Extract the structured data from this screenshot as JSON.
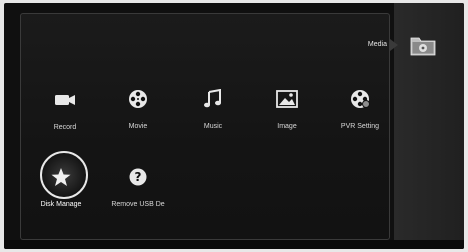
{
  "header": {
    "current_section": "Media"
  },
  "menu": {
    "items": [
      {
        "label": "Record",
        "icon": "camera-icon"
      },
      {
        "label": "Movie",
        "icon": "film-reel-icon"
      },
      {
        "label": "Music",
        "icon": "music-note-icon"
      },
      {
        "label": "Image",
        "icon": "picture-icon"
      },
      {
        "label": "PVR Setting",
        "icon": "film-reel-gear-icon"
      },
      {
        "label": "Disk Manage",
        "icon": "star-icon",
        "selected": true
      },
      {
        "label": "Remove USB De",
        "icon": "question-icon"
      }
    ]
  },
  "sidebar": {
    "icon": "folder-icon"
  },
  "colors": {
    "background": "#101010",
    "text": "#d8d8d8",
    "highlight": "#e8e8e8"
  }
}
